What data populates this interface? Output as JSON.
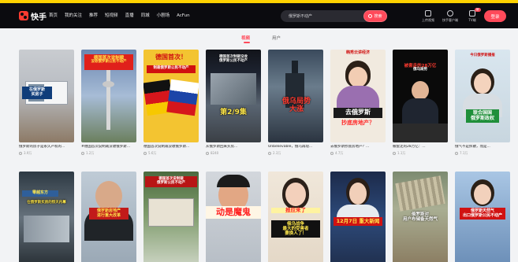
{
  "brand": {
    "name": "快手"
  },
  "nav": {
    "items": [
      "首页",
      "我的关注",
      "推荐",
      "短视频",
      "直播",
      "同城",
      "小剧场",
      "AcFun"
    ]
  },
  "search": {
    "value": "俄罗斯不动产",
    "button": "搜索"
  },
  "tools": {
    "upload": "上传视频",
    "client": "快手客户端",
    "tv": "TV端",
    "tv_badge": "新",
    "login": "登录"
  },
  "tabs": {
    "active": "视频",
    "other": "用户"
  },
  "row1": [
    {
      "caption": "俄罗斯的房子是永久产权的...",
      "likes": "3.9万",
      "overlay": [
        "在俄罗斯",
        "买房子"
      ]
    },
    {
      "caption": "#德国首次说制裁没收俄罗斯...",
      "likes": "1.2万",
      "overlay": [
        "德国首次说制裁",
        "没收俄罗斯公民不动产"
      ]
    },
    {
      "caption": "德国首次说制裁没收俄罗斯...",
      "likes": "5.6万",
      "overlay": [
        "德国首次！",
        "制裁俄罗斯公民不动产"
      ]
    },
    {
      "caption": "从俄罗斯回来买房...",
      "likes": "8240",
      "overlay": [
        "德国首次制裁没收",
        "俄罗斯公民不动产",
        "第2/9集"
      ]
    },
    {
      "caption": "Unbelievable，俄乌再现...",
      "likes": "2.3万",
      "overlay": [
        "俄乌局势",
        "大涨"
      ]
    },
    {
      "caption": "去俄罗斯抄底房地产？...",
      "likes": "4.7万",
      "overlay": [
        "韩秀云讲经济",
        "去俄罗斯",
        "抄底房地产？"
      ]
    },
    {
      "caption": "被套走的28万亿：...",
      "likes": "1.1万",
      "overlay": [
        "被套走的28万亿",
        "俄乌局势"
      ]
    },
    {
      "caption": "俄气不是拆散，而是...",
      "likes": "7.1万",
      "overlay": [
        "今日俄罗斯播报",
        "联合国国",
        "俄罗斯政权"
      ]
    }
  ],
  "row2": [
    {
      "overlay": [
        "零越东方",
        "在俄罗斯买房的惊天内幕"
      ]
    },
    {
      "overlay": [
        "俄罗斯房地产",
        "进行重大改革"
      ]
    },
    {
      "overlay": [
        "德国首次说制裁",
        "俄罗斯公民不动产"
      ]
    },
    {
      "overlay": [
        "动是魔鬼"
      ]
    },
    {
      "overlay": [
        "报应来了",
        "俄乌战争",
        "最大的受害者",
        "要换人了！"
      ]
    },
    {
      "overlay": [
        "12月7日",
        "重大新闻"
      ]
    },
    {
      "overlay": [
        "俄罗斯对",
        "用户布储备天然气"
      ]
    },
    {
      "overlay": [
        "俄罗斯天然气",
        "出口俄罗斯公民不动产"
      ]
    }
  ],
  "colors": {
    "accent": "#ff4a5a",
    "nav_bg": "#0b0b0f",
    "topbar": "#ffd200"
  }
}
